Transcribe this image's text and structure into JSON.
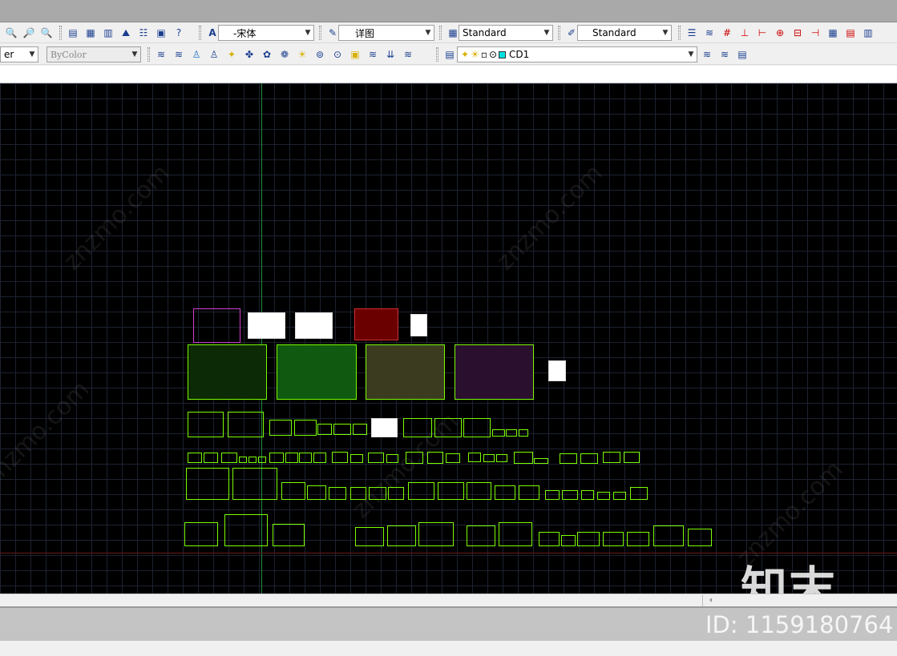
{
  "toolbar1": {
    "text_style_combo": "-宋体",
    "dim_style_combo": "详图",
    "table_style_combo": "Standard",
    "multileader_style_combo": "Standard"
  },
  "toolbar2": {
    "linetype_combo": "er",
    "color_combo": "ByColor",
    "layer_combo": "CD1"
  },
  "canvas": {
    "background": "#000000",
    "sheet_color": "#7CFC00",
    "watermark": "znzmo.com"
  },
  "overlay": {
    "logo": "知末",
    "id": "ID: 1159180764"
  },
  "scrollbar": {
    "left_arrow": "‹"
  }
}
